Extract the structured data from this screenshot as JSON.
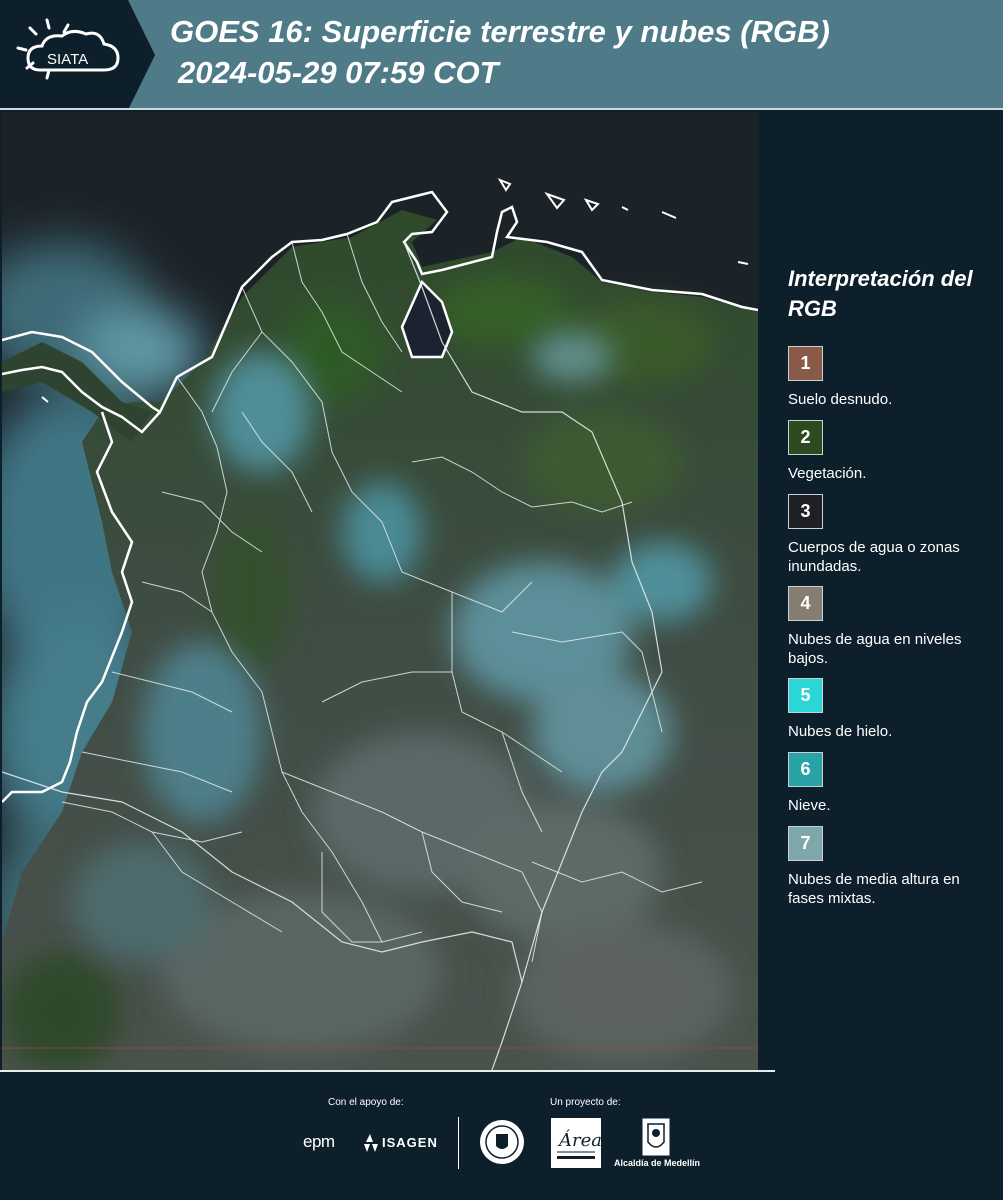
{
  "header": {
    "logo_text": "SIATA",
    "title_line1": "GOES 16: Superficie terrestre y nubes (RGB)",
    "title_line2": "2024-05-29 07:59 COT"
  },
  "legend": {
    "title": "Interpretación del RGB",
    "items": [
      {
        "number": "1",
        "label": "Suelo desnudo.",
        "color": "#8a5a48"
      },
      {
        "number": "2",
        "label": "Vegetación.",
        "color": "#2d4a20"
      },
      {
        "number": "3",
        "label": "Cuerpos de agua o zonas inundadas.",
        "color": "#1e2024"
      },
      {
        "number": "4",
        "label": "Nubes de agua en niveles bajos.",
        "color": "#857d72"
      },
      {
        "number": "5",
        "label": "Nubes de hielo.",
        "color": "#2bd6d6"
      },
      {
        "number": "6",
        "label": "Nieve.",
        "color": "#2aa3a6"
      },
      {
        "number": "7",
        "label": "Nubes de media altura en fases mixtas.",
        "color": "#7ea7aa"
      }
    ]
  },
  "footer": {
    "support_label": "Con el apoyo de:",
    "project_label": "Un proyecto de:",
    "sponsor1": "epm",
    "sponsor2": "ISAGEN",
    "partner1": "Área Metropolitana Valle de Aburrá",
    "partner2": "Alcaldía de Medellín"
  },
  "colors": {
    "header_bg": "#4f7a87",
    "page_bg": "#0d1f2b",
    "boundary": "#ffffff"
  }
}
